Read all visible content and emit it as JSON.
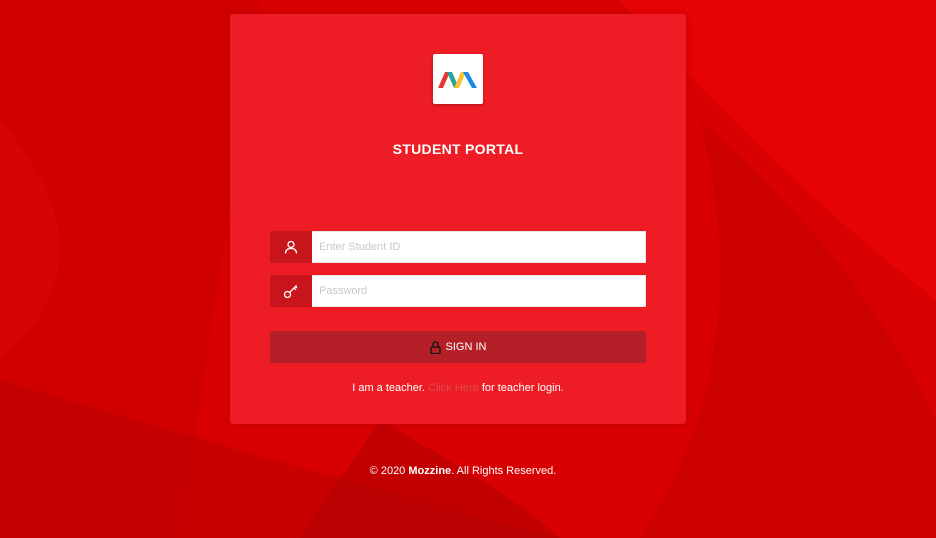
{
  "portal": {
    "title": "STUDENT PORTAL"
  },
  "form": {
    "student_id_placeholder": "Enter Student ID",
    "password_placeholder": "Password",
    "signin_label": "SIGN IN"
  },
  "teacher": {
    "prefix": "I am a teacher.",
    "link_text": "Click Here",
    "suffix": "for teacher login."
  },
  "footer": {
    "copyright": "© 2020",
    "brand": "Mozzine",
    "rights": ". All Rights Reserved."
  },
  "icons": {
    "logo": "mozzine-logo",
    "user": "user-icon",
    "key": "key-icon",
    "lock": "lock-icon"
  },
  "colors": {
    "background": "#d90000",
    "card": "#ee1d25",
    "button": "#b52028",
    "icon_box": "#c8151b"
  }
}
